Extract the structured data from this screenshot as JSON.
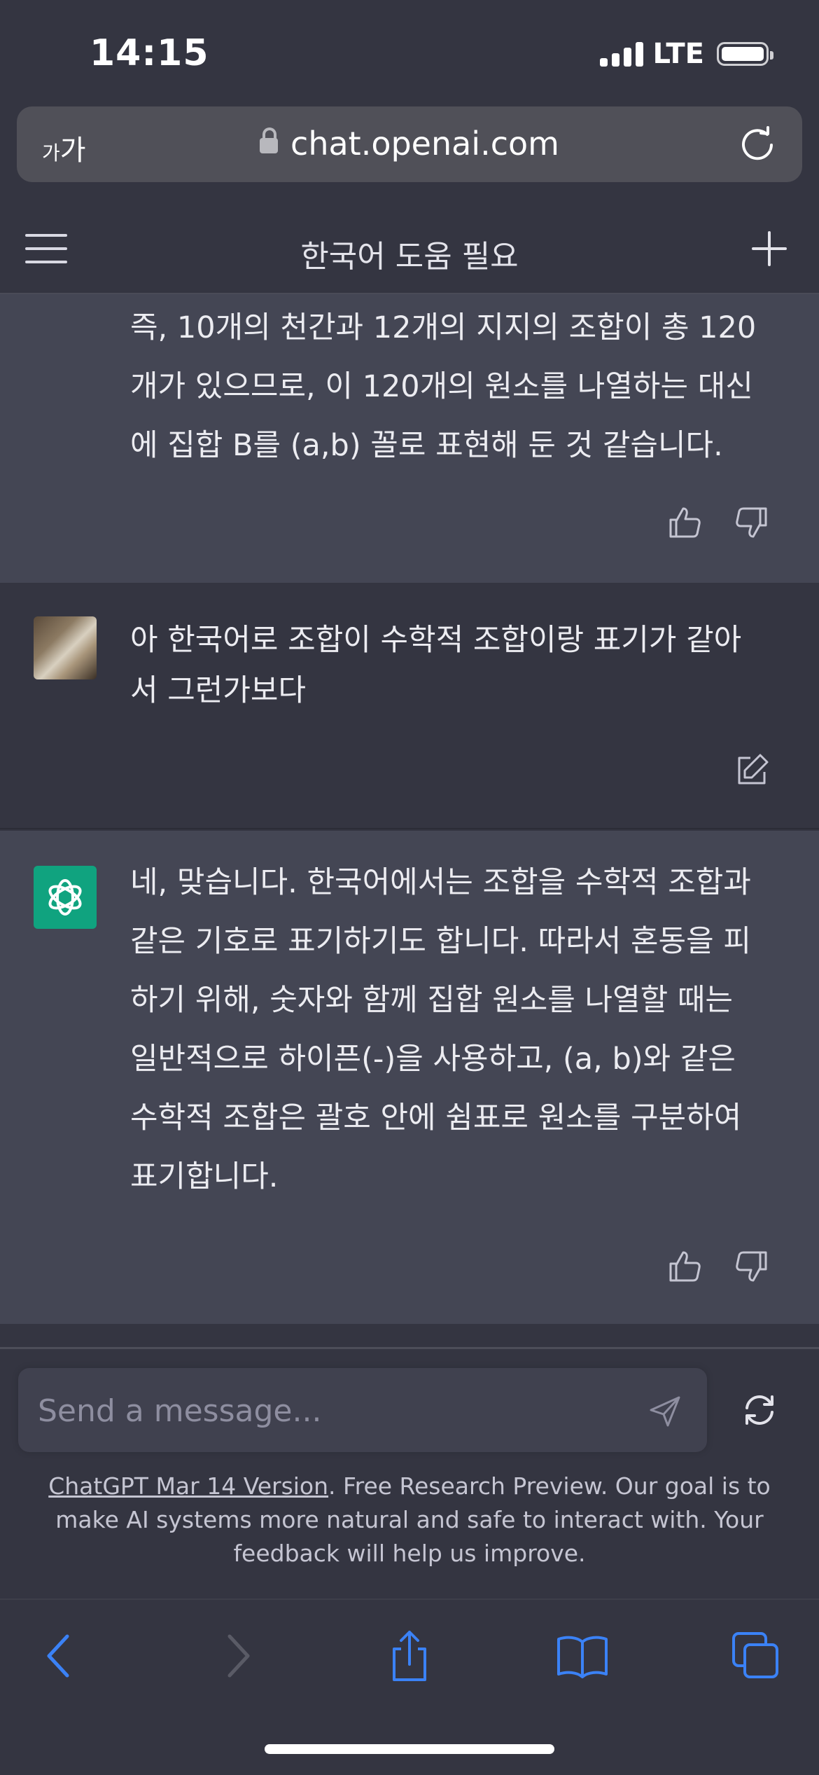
{
  "status_bar": {
    "time": "14:15",
    "network": "LTE"
  },
  "browser": {
    "text_size_small": "가",
    "text_size_large": "가",
    "url": "chat.openai.com"
  },
  "header": {
    "title": "한국어 도움 필요"
  },
  "messages": [
    {
      "role": "assistant",
      "lines": [
        "즉, 10개의 천간과 12개의 지지의 조합이 총 120",
        "개가 있으므로, 이 120개의 원소를 나열하는 대신",
        "에 집합 B를 (a,b) 꼴로 표현해 둔 것 같습니다."
      ]
    },
    {
      "role": "user",
      "lines": [
        "아 한국어로 조합이 수학적 조합이랑 표기가 같아",
        "서 그런가보다"
      ]
    },
    {
      "role": "assistant",
      "lines": [
        "네, 맞습니다. 한국어에서는 조합을 수학적 조합과",
        "같은 기호로 표기하기도 합니다. 따라서 혼동을 피",
        "하기 위해, 숫자와 함께 집합 원소를 나열할 때는",
        "일반적으로 하이픈(-)을 사용하고, (a, b)와 같은",
        "수학적 조합은 괄호 안에 쉼표로 원소를 구분하여",
        "표기합니다."
      ]
    }
  ],
  "composer": {
    "placeholder": "Send a message..."
  },
  "footer": {
    "link": "ChatGPT Mar 14 Version",
    "text": ". Free Research Preview. Our goal is to make AI systems more natural and safe to interact with. Your feedback will help us improve."
  },
  "colors": {
    "background": "#343541",
    "assistant_bg": "#444654",
    "gpt_green": "#10a37f",
    "safari_blue": "#3b82f6"
  }
}
